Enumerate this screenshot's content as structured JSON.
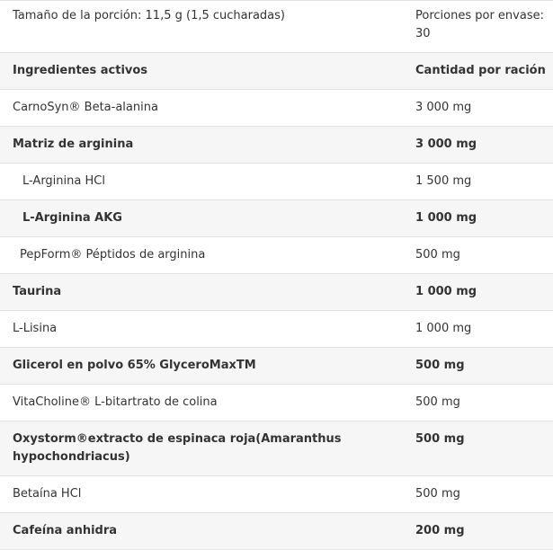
{
  "header": {
    "serving_size": "Tamaño de la porción: 11,5 g (1,5 cucharadas)",
    "servings_per_container": "Porciones por envase: 30"
  },
  "columns": {
    "ingredients": "Ingredientes activos",
    "amount": "Cantidad por ración"
  },
  "rows": [
    {
      "name": "CarnoSyn® Beta-alanina",
      "amount": "3 000 mg"
    },
    {
      "name": "Matriz de arginina",
      "amount": "3 000 mg"
    },
    {
      "name": "L-Arginina HCl",
      "amount": "1 500 mg"
    },
    {
      "name": "L-Arginina AKG",
      "amount": "1 000 mg"
    },
    {
      "name": "PepForm® Péptidos de arginina",
      "amount": "500 mg"
    },
    {
      "name": "Taurina",
      "amount": "1 000 mg"
    },
    {
      "name": "L-Lisina",
      "amount": "1 000 mg"
    },
    {
      "name": "Glicerol en polvo 65% GlyceroMaxTM",
      "amount": "500 mg"
    },
    {
      "name": "VitaCholine® L-bitartrato de colina",
      "amount": "500 mg"
    },
    {
      "name": "Oxystorm®extracto de espinaca roja(Amaranthus hypochondriacus)",
      "amount": "500 mg"
    },
    {
      "name": "Betaína HCl",
      "amount": "500 mg"
    },
    {
      "name": "Cafeína anhidra",
      "amount": "200 mg"
    }
  ]
}
